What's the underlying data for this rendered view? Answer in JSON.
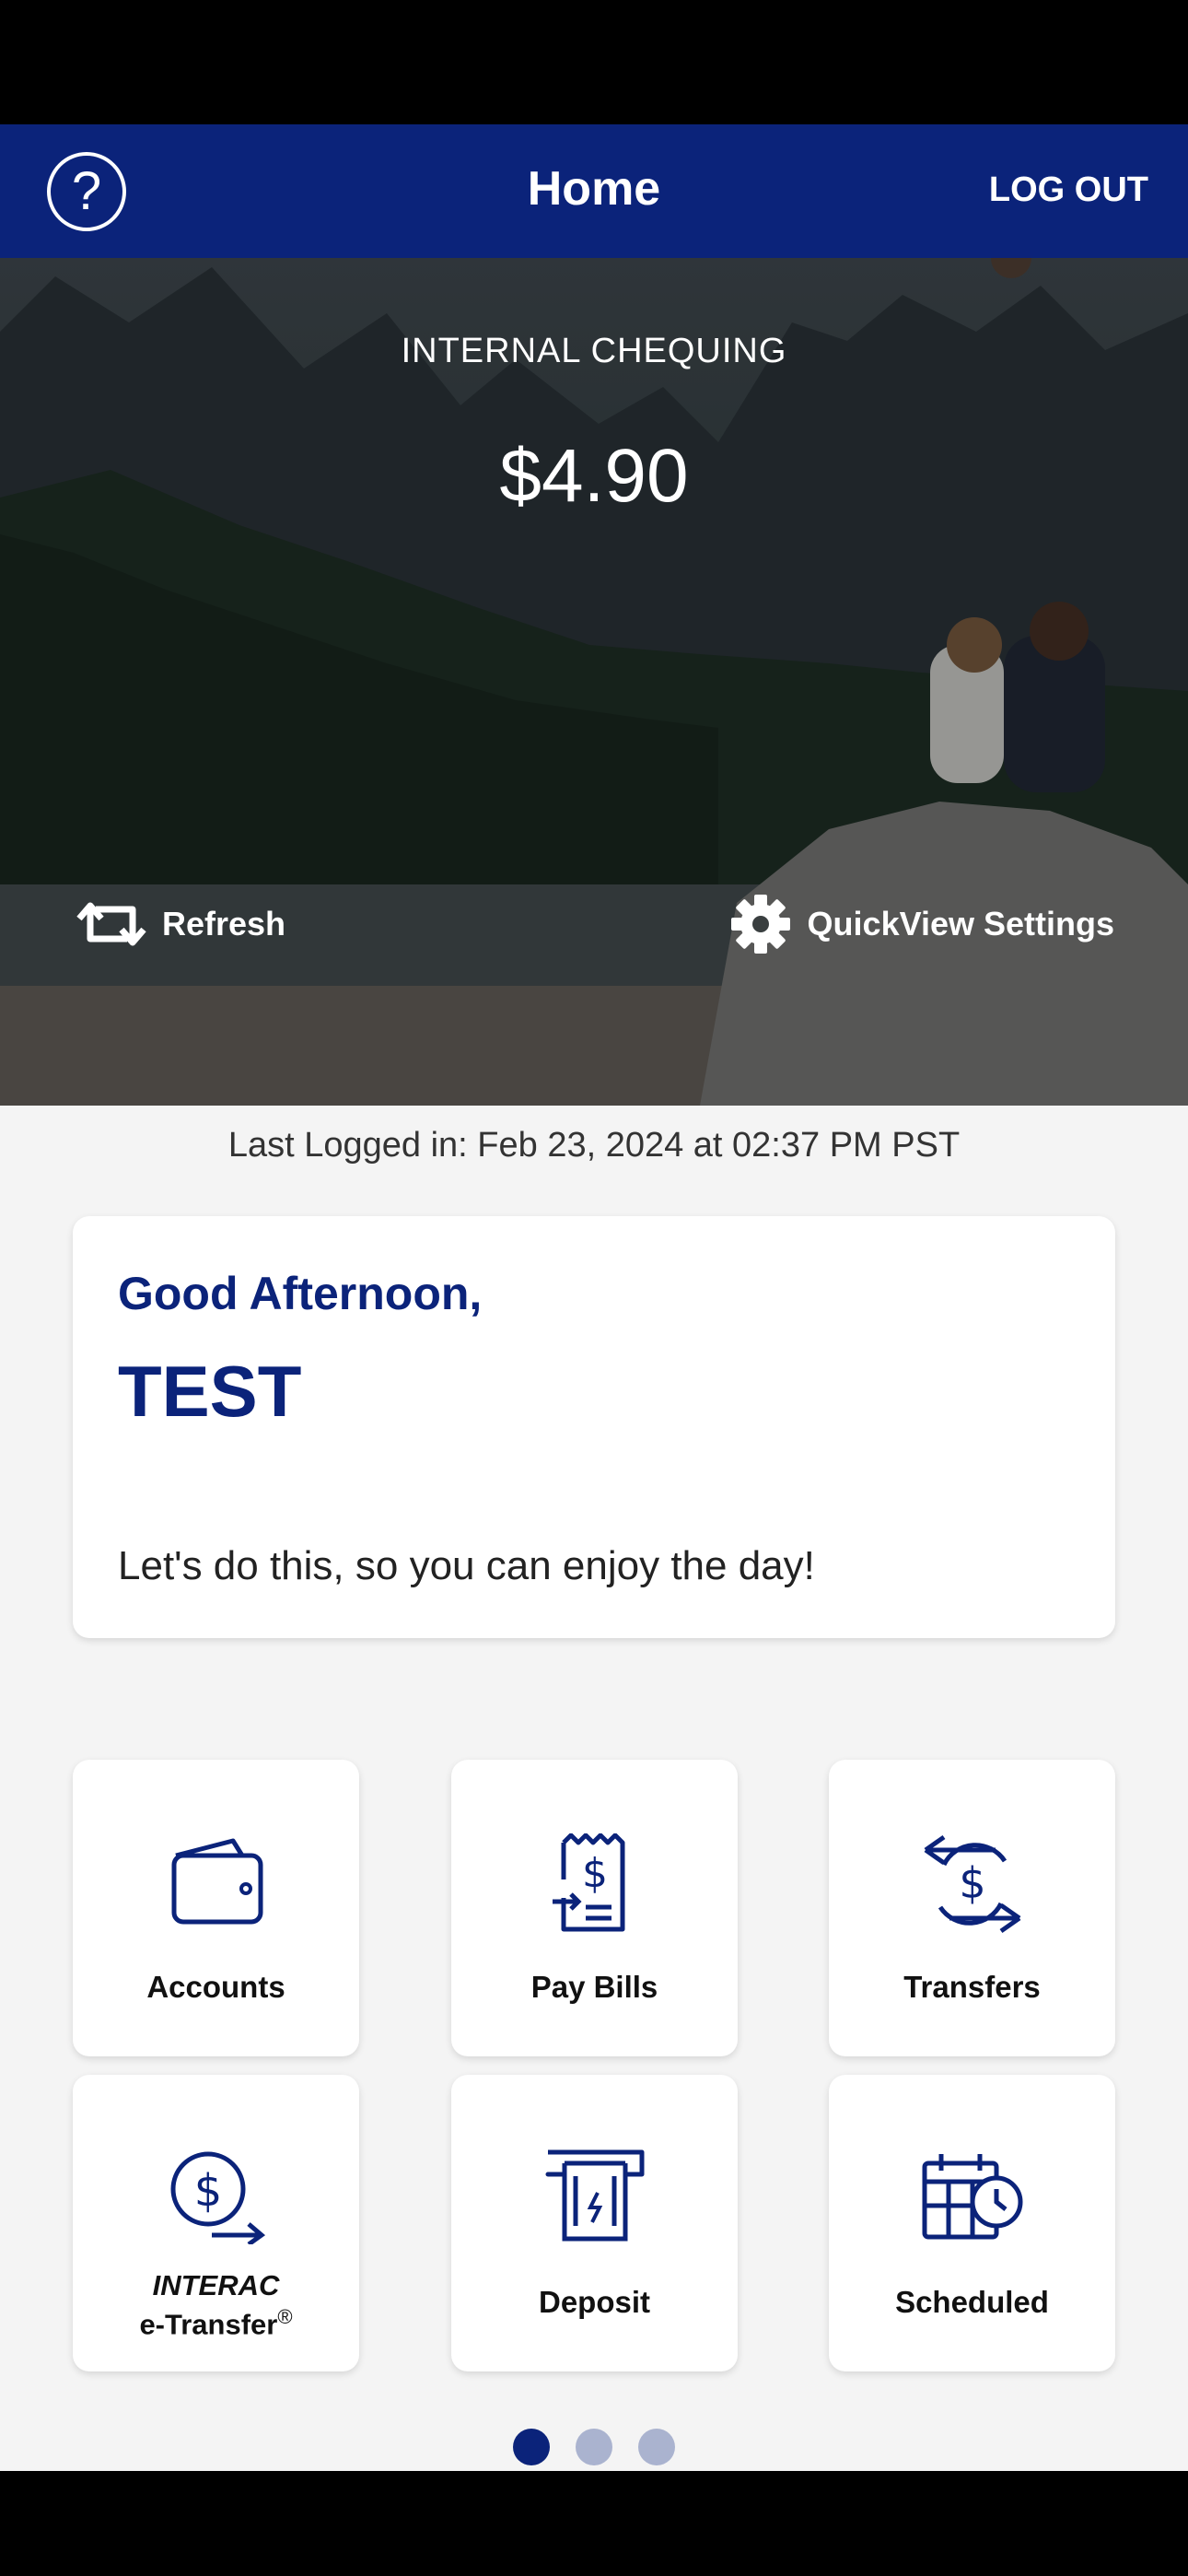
{
  "header": {
    "help_icon": "question-circle-icon",
    "help_glyph": "?",
    "title": "Home",
    "logout_label": "LOG OUT"
  },
  "quickview": {
    "account_name": "INTERNAL CHEQUING",
    "balance": "$4.90",
    "refresh_label": "Refresh",
    "settings_label": "QuickView Settings"
  },
  "last_login": "Last Logged in: Feb 23, 2024 at 02:37 PM  PST",
  "greeting": {
    "salutation": "Good Afternoon,",
    "name": "TEST",
    "message": "Let's do this, so you can enjoy the day!"
  },
  "tiles": [
    {
      "label": "Accounts",
      "icon": "wallet-icon"
    },
    {
      "label": "Pay Bills",
      "icon": "bill-icon"
    },
    {
      "label": "Transfers",
      "icon": "transfer-icon"
    },
    {
      "label_line1": "INTERAC",
      "label_line2": "e-Transfer",
      "label_sup": "®",
      "icon": "etransfer-icon"
    },
    {
      "label": "Deposit",
      "icon": "deposit-icon"
    },
    {
      "label": "Scheduled",
      "icon": "scheduled-icon"
    }
  ],
  "pagination": {
    "pages": 3,
    "active": 1
  },
  "colors": {
    "brand": "#0b237a",
    "background": "#f4f4f4",
    "dot_inactive": "#aab3cf"
  }
}
